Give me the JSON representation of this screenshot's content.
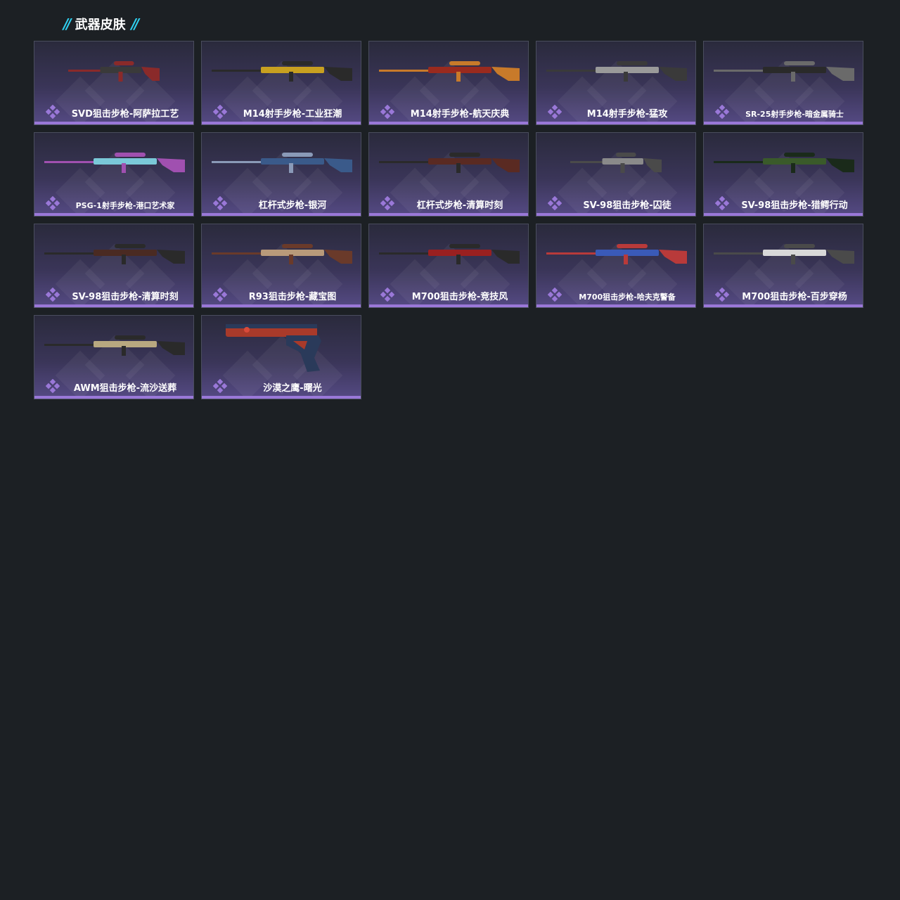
{
  "header": {
    "title": "武器皮肤"
  },
  "colors": {
    "background": "#1c2024",
    "accent_cyan": "#2fd0f0",
    "rarity_purple": "#9a78d8"
  },
  "items": [
    {
      "name": "SVD狙击步枪-阿萨拉工艺",
      "kind": "rifle-short",
      "c1": "#3a3a3a",
      "c2": "#8a2a2a"
    },
    {
      "name": "M14射手步枪-工业狂潮",
      "kind": "rifle",
      "c1": "#c8a020",
      "c2": "#2a2a2a"
    },
    {
      "name": "M14射手步枪-航天庆典",
      "kind": "rifle",
      "c1": "#9a2a1e",
      "c2": "#c87a2a"
    },
    {
      "name": "M14射手步枪-猛攻",
      "kind": "rifle",
      "c1": "#9a9a9a",
      "c2": "#3a3a3a"
    },
    {
      "name": "SR-25射手步枪-暗金属骑士",
      "kind": "rifle",
      "c1": "#2a2a2a",
      "c2": "#6a6a6a",
      "small": true
    },
    {
      "name": "PSG-1射手步枪-港口艺术家",
      "kind": "rifle",
      "c1": "#7ac8d8",
      "c2": "#a050b0",
      "small": true
    },
    {
      "name": "杠杆式步枪-银河",
      "kind": "lever",
      "c1": "#3a5a8a",
      "c2": "#8a9ab8"
    },
    {
      "name": "杠杆式步枪-清算时刻",
      "kind": "lever",
      "c1": "#5a2a22",
      "c2": "#2a2a2a"
    },
    {
      "name": "SV-98狙击步枪-囚徒",
      "kind": "rifle-short",
      "c1": "#8a8a8a",
      "c2": "#4a4a4a"
    },
    {
      "name": "SV-98狙击步枪-猎鳄行动",
      "kind": "rifle",
      "c1": "#3a5a2a",
      "c2": "#1a2a1a"
    },
    {
      "name": "SV-98狙击步枪-清算时刻",
      "kind": "rifle",
      "c1": "#4a2a22",
      "c2": "#2a2a2a"
    },
    {
      "name": "R93狙击步枪-藏宝图",
      "kind": "rifle",
      "c1": "#b89a7a",
      "c2": "#6a3a2a"
    },
    {
      "name": "M700狙击步枪-竞技风",
      "kind": "rifle",
      "c1": "#9a2020",
      "c2": "#2a2a2a"
    },
    {
      "name": "M700狙击步枪-哈夫克警备",
      "kind": "rifle",
      "c1": "#3a5ab8",
      "c2": "#b83a3a",
      "small": true
    },
    {
      "name": "M700狙击步枪-百步穿杨",
      "kind": "rifle",
      "c1": "#d8d8d8",
      "c2": "#4a4a4a"
    },
    {
      "name": "AWM狙击步枪-流沙送葬",
      "kind": "rifle",
      "c1": "#b8a880",
      "c2": "#2a2a2a"
    },
    {
      "name": "沙漠之鹰-曙光",
      "kind": "pistol",
      "c1": "#a83a2a",
      "c2": "#2a3a5a"
    }
  ]
}
